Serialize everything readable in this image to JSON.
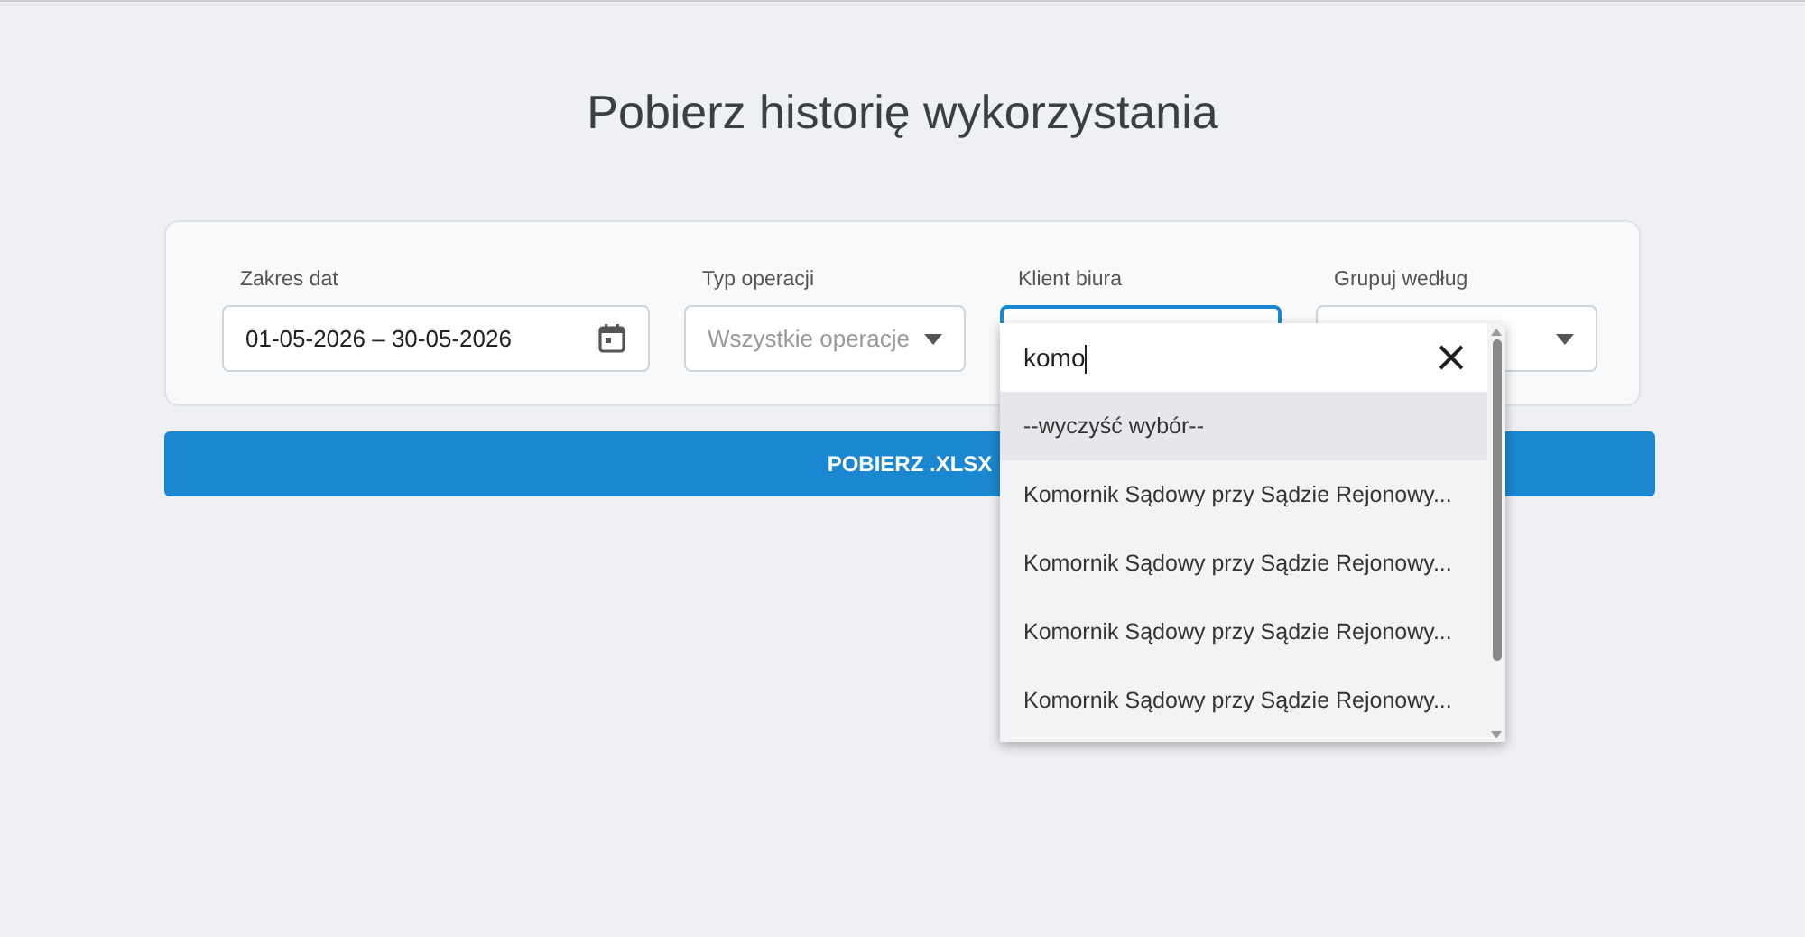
{
  "title": "Pobierz historię wykorzystania",
  "fields": [
    {
      "kind": "date",
      "label": "Zakres dat",
      "value": "01-05-2026 – 30-05-2026",
      "focused": false
    },
    {
      "kind": "select",
      "label": "Typ operacji",
      "placeholder": "Wszystkie operacje",
      "focused": false
    },
    {
      "kind": "select",
      "label": "Klient biura",
      "focused": true
    },
    {
      "kind": "select",
      "label": "Grupuj według",
      "focused": false
    }
  ],
  "download_button": "POBIERZ .XLSX",
  "dropdown": {
    "search_value": "komo",
    "options": [
      {
        "label": "--wyczyść wybór--",
        "selected": true
      },
      {
        "label": "Komornik Sądowy przy Sądzie Rejonowy...",
        "selected": false
      },
      {
        "label": "Komornik Sądowy przy Sądzie Rejonowy...",
        "selected": false
      },
      {
        "label": "Komornik Sądowy przy Sądzie Rejonowy...",
        "selected": false
      },
      {
        "label": "Komornik Sądowy przy Sądzie Rejonowy...",
        "selected": false
      }
    ]
  }
}
